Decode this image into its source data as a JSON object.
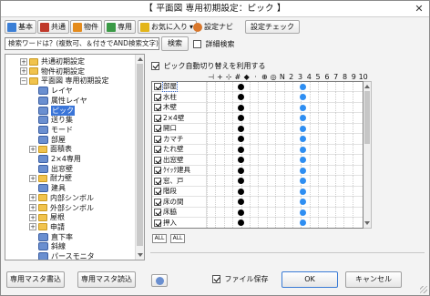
{
  "window": {
    "title": "【 平面図 専用初期設定：ピック 】",
    "close_glyph": "✕"
  },
  "toolbar": {
    "buttons": [
      {
        "label": "基本",
        "icon": "basic-settings-icon",
        "color": "#3b7fd6"
      },
      {
        "label": "共通",
        "icon": "common-settings-icon",
        "color": "#c0392b"
      },
      {
        "label": "物件",
        "icon": "property-icon",
        "color": "#e48b1c"
      },
      {
        "label": "専用",
        "icon": "dedicated-icon",
        "color": "#3a9a46"
      },
      {
        "label": "お気に入り",
        "icon": "favorite-icon",
        "color": "#e3b51a"
      }
    ],
    "favorite_dropdown_glyph": "▾",
    "config_navi_label": "設定ナビ",
    "config_check_label": "設定チェック"
  },
  "search": {
    "value": "検索ワードは？(複数可、＆付きでAND検索文字)",
    "button_label": "検索",
    "detail_label": "詳細検索",
    "detail_checked": false
  },
  "tree": {
    "nodes": [
      {
        "label": "共通初期設定",
        "level": 0,
        "kind": "folder",
        "expander": "+"
      },
      {
        "label": "物件初期設定",
        "level": 0,
        "kind": "folder",
        "expander": "+"
      },
      {
        "label": "平面図 専用初期設定",
        "level": 0,
        "kind": "folder-open",
        "expander": "−"
      },
      {
        "label": "レイヤ",
        "level": 1,
        "kind": "item"
      },
      {
        "label": "属性レイヤ",
        "level": 1,
        "kind": "item"
      },
      {
        "label": "ピック",
        "level": 1,
        "kind": "item",
        "selected": true
      },
      {
        "label": "送り集",
        "level": 1,
        "kind": "item"
      },
      {
        "label": "モード",
        "level": 1,
        "kind": "item"
      },
      {
        "label": "部屋",
        "level": 1,
        "kind": "item"
      },
      {
        "label": "面積表",
        "level": 1,
        "kind": "folder",
        "expander": "+"
      },
      {
        "label": "2×4専用",
        "level": 1,
        "kind": "item"
      },
      {
        "label": "出窓壁",
        "level": 1,
        "kind": "item"
      },
      {
        "label": "耐力壁",
        "level": 1,
        "kind": "folder",
        "expander": "+"
      },
      {
        "label": "建具",
        "level": 1,
        "kind": "item"
      },
      {
        "label": "内部シンボル",
        "level": 1,
        "kind": "folder",
        "expander": "+"
      },
      {
        "label": "外部シンボル",
        "level": 1,
        "kind": "folder",
        "expander": "+"
      },
      {
        "label": "屋根",
        "level": 1,
        "kind": "folder",
        "expander": "+"
      },
      {
        "label": "申請",
        "level": 1,
        "kind": "folder",
        "expander": "+"
      },
      {
        "label": "直下率",
        "level": 1,
        "kind": "item"
      },
      {
        "label": "斜線",
        "level": 1,
        "kind": "item"
      },
      {
        "label": "パースモニタ",
        "level": 1,
        "kind": "item"
      }
    ]
  },
  "pick": {
    "use_auto_label": "ピック自動切り替えを利用する",
    "use_auto_checked": true,
    "header_glyphs": [
      "⊣",
      "+",
      "⊹",
      "#",
      "◆",
      "·",
      "⊕",
      "◎",
      "N",
      "2",
      "3",
      "4",
      "5",
      "6",
      "7",
      "8",
      "9",
      "10"
    ],
    "rows": [
      {
        "label": "部屋",
        "checked": true,
        "selected": true
      },
      {
        "label": "水柱",
        "checked": true
      },
      {
        "label": "木壁",
        "checked": true
      },
      {
        "label": "2×4壁",
        "checked": true
      },
      {
        "label": "開口",
        "checked": true
      },
      {
        "label": "カマチ",
        "checked": true
      },
      {
        "label": "たれ壁",
        "checked": true
      },
      {
        "label": "出窓壁",
        "checked": true
      },
      {
        "label": "ｸｲｯｸ建具",
        "checked": true
      },
      {
        "label": "窓、戸",
        "checked": true
      },
      {
        "label": "階段",
        "checked": true
      },
      {
        "label": "床の間",
        "checked": true
      },
      {
        "label": "床脇",
        "checked": true
      },
      {
        "label": "押入",
        "checked": true
      }
    ],
    "all_on_label": "ALL",
    "all_off_label": "ALL"
  },
  "footer": {
    "export_label": "専用マスタ書込",
    "import_label": "専用マスタ読込",
    "file_save_label": "ファイル保存",
    "file_save_checked": true,
    "ok_label": "OK",
    "cancel_label": "キャンセル"
  }
}
